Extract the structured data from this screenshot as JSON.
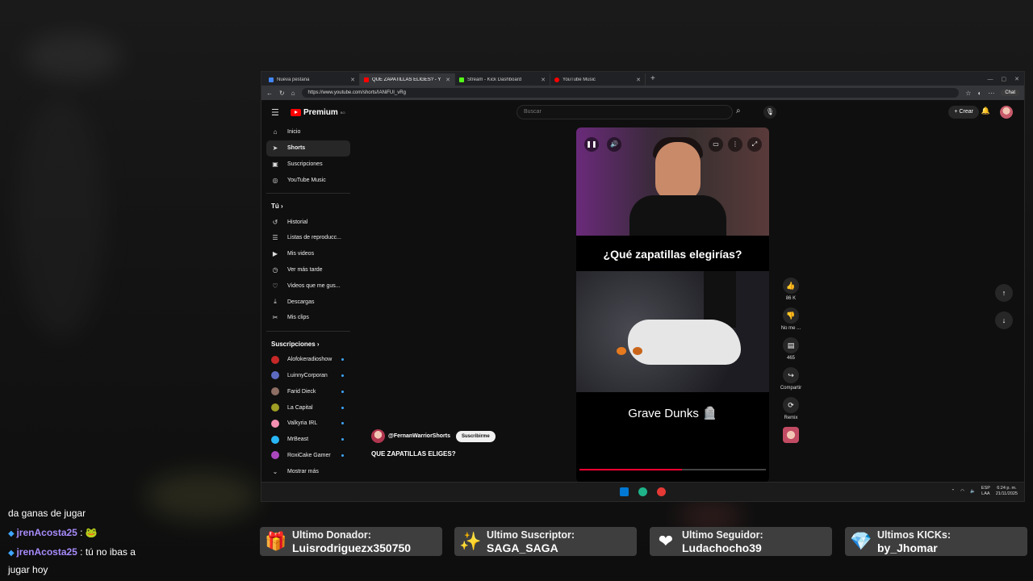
{
  "browser": {
    "tabs": [
      {
        "title": "Nueva pestaña",
        "color": "#4285f4"
      },
      {
        "title": "QUE ZAPATILLAS ELIGES? - Y",
        "color": "#ff0000"
      },
      {
        "title": "Stream - Kick Dashboard",
        "color": "#53fc18"
      },
      {
        "title": "YouTube Music",
        "color": "#ff0000"
      }
    ],
    "url": "https://www.youtube.com/shorts/IANiFUI_vRg",
    "chat_button": "Chat"
  },
  "youtube": {
    "logo": "Premium",
    "logo_sup": "BO",
    "search_placeholder": "Buscar",
    "create_label": "Crear",
    "nav": [
      {
        "label": "Inicio",
        "icon": "home-icon",
        "glyph": "⌂"
      },
      {
        "label": "Shorts",
        "icon": "shorts-icon",
        "glyph": "➤"
      },
      {
        "label": "Suscripciones",
        "icon": "subscriptions-icon",
        "glyph": "▣"
      },
      {
        "label": "YouTube Music",
        "icon": "music-icon",
        "glyph": "◎"
      }
    ],
    "you_heading": "Tú",
    "you_items": [
      {
        "label": "Historial",
        "icon": "history-icon",
        "glyph": "↺"
      },
      {
        "label": "Listas de reproducc...",
        "icon": "playlists-icon",
        "glyph": "☰"
      },
      {
        "label": "Mis videos",
        "icon": "my-videos-icon",
        "glyph": "▶"
      },
      {
        "label": "Ver más tarde",
        "icon": "watch-later-icon",
        "glyph": "◷"
      },
      {
        "label": "Videos que me gus...",
        "icon": "liked-videos-icon",
        "glyph": "♡"
      },
      {
        "label": "Descargas",
        "icon": "download-icon",
        "glyph": "⤓"
      },
      {
        "label": "Mis clips",
        "icon": "clips-icon",
        "glyph": "✂"
      }
    ],
    "subs_heading": "Suscripciones",
    "subscriptions": [
      {
        "label": "Alofokeradioshow",
        "color": "#c62828"
      },
      {
        "label": "LuinnyCorporan",
        "color": "#5c6bc0"
      },
      {
        "label": "Farid Dieck",
        "color": "#8d6e63"
      },
      {
        "label": "La Capital",
        "color": "#9e9d24"
      },
      {
        "label": "Valkyria IRL",
        "color": "#f48fb1"
      },
      {
        "label": "MrBeast",
        "color": "#29b6f6"
      },
      {
        "label": "RoxiCake Gamer",
        "color": "#ab47bc"
      }
    ],
    "show_more": "Mostrar más",
    "short": {
      "question": "¿Qué zapatillas elegirías?",
      "caption": "Grave Dunks 🪦",
      "likes": "86 K",
      "dislike_label": "No me ...",
      "comments": "465",
      "share_label": "Compartir",
      "remix_label": "Remix",
      "channel": "@FernanWarriorShorts",
      "subscribe_label": "Suscribirme",
      "title": "QUE ZAPATILLAS ELIGES?"
    }
  },
  "taskbar": {
    "lang_top": "ESP",
    "lang_bottom": "LAA",
    "time": "6:24 p. m.",
    "date": "21/11/2025"
  },
  "chat": [
    {
      "text": "da ganas de jugar"
    },
    {
      "user": "jrenAcosta25",
      "sep": " :",
      "text": " 🐸"
    },
    {
      "user": "jrenAcosta25",
      "sep": " :",
      "text": " tú no ibas a"
    },
    {
      "text": "jugar hoy"
    }
  ],
  "stats": [
    {
      "label": "Ultimo Donador:",
      "value": "Luisrodriguezx350750",
      "icon": "gift-icon",
      "glyph": "🎁"
    },
    {
      "label": "Ultimo Suscriptor:",
      "value": "SAGA_SAGA",
      "icon": "sparkles-icon",
      "glyph": "✨"
    },
    {
      "label": "Ultimo Seguidor:",
      "value": "Ludachocho39",
      "icon": "heart-icon",
      "glyph": "❤"
    },
    {
      "label": "Ultimos KICKs:",
      "value": "by_Jhomar",
      "icon": "gem-icon",
      "glyph": "💎"
    }
  ]
}
